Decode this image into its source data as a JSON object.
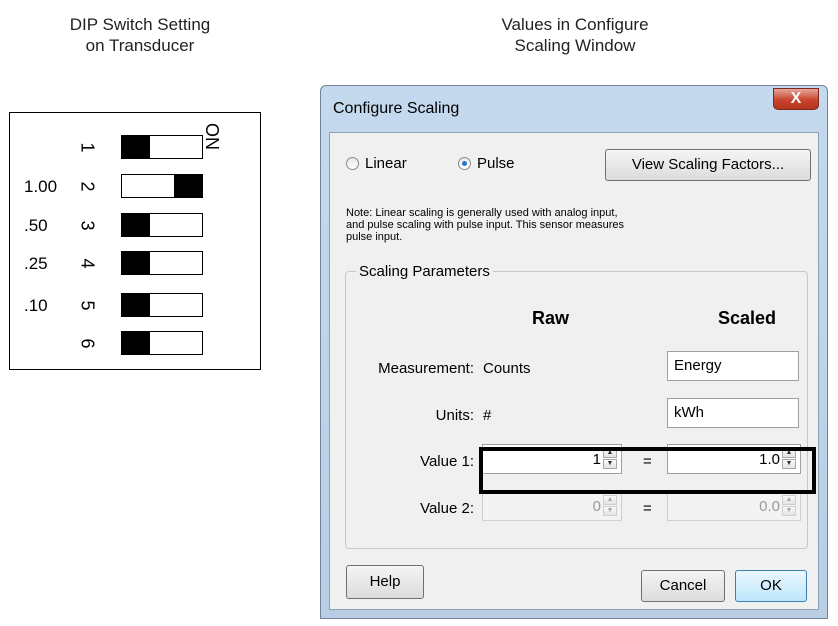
{
  "headings": {
    "left_line1": "DIP Switch Setting",
    "left_line2": "on Transducer",
    "right_line1": "Values in Configure",
    "right_line2": "Scaling Window"
  },
  "dip": {
    "on_label": "ON",
    "rows": [
      {
        "value": "",
        "number": "1",
        "state": "off"
      },
      {
        "value": "1.00",
        "number": "2",
        "state": "on"
      },
      {
        "value": ".50",
        "number": "3",
        "state": "off"
      },
      {
        "value": ".25",
        "number": "4",
        "state": "off"
      },
      {
        "value": ".10",
        "number": "5",
        "state": "off"
      },
      {
        "value": "",
        "number": "6",
        "state": "off"
      }
    ]
  },
  "window": {
    "title": "Configure Scaling",
    "close_glyph": "X",
    "radio_linear": "Linear",
    "radio_pulse": "Pulse",
    "selected_mode": "Pulse",
    "view_button": "View Scaling Factors...",
    "note_line1": "Note: Linear scaling is generally used with analog input,",
    "note_line2": "and pulse scaling with pulse input. This sensor measures",
    "note_line3": "pulse input.",
    "group_label": "Scaling Parameters",
    "col_raw": "Raw",
    "col_scaled": "Scaled",
    "measurement_label": "Measurement:",
    "measurement_raw": "Counts",
    "measurement_scaled": "Energy",
    "units_label": "Units:",
    "units_raw": "#",
    "units_scaled": "kWh",
    "value1_label": "Value 1:",
    "value1_raw": "1",
    "value1_scaled": "1.0",
    "value2_label": "Value 2:",
    "value2_raw": "0",
    "value2_scaled": "0.0",
    "equals": "=",
    "help_button": "Help",
    "cancel_button": "Cancel",
    "ok_button": "OK"
  },
  "colors": {
    "highlight": "#000000",
    "accent_ok": "#3c7fb1"
  }
}
